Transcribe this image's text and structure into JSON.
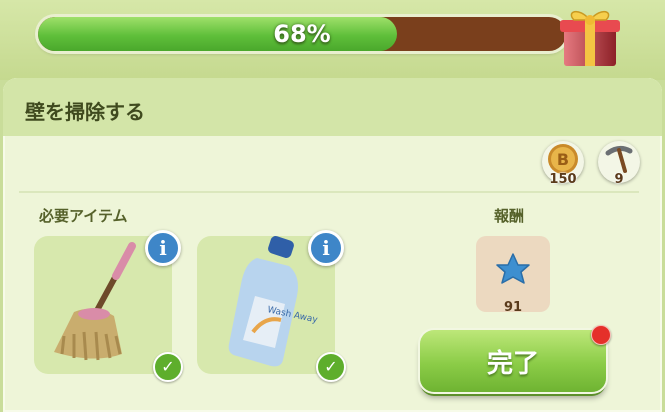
{
  "progress": {
    "value": 0.68,
    "label": "68%"
  },
  "task": {
    "title": "壁を掃除する"
  },
  "costs": [
    {
      "icon": "coin-icon",
      "count": "150"
    },
    {
      "icon": "pickaxe-icon",
      "count": "9"
    }
  ],
  "required": {
    "label": "必要アイテム",
    "items": [
      {
        "icon": "mop-icon",
        "status": "check-icon"
      },
      {
        "icon": "wash-away-bottle-icon",
        "status": "check-icon",
        "bottle_text": "Wash Away"
      }
    ]
  },
  "reward": {
    "label": "報酬",
    "icon": "blue-star-icon",
    "count": "91"
  },
  "complete_button": {
    "label": "完了"
  },
  "colors": {
    "progress_fill": "#5fbf3a",
    "progress_track": "#7a3f1c",
    "info_button": "#3e86c8",
    "complete_button": "#8bcc47",
    "notification": "#e5302a"
  }
}
